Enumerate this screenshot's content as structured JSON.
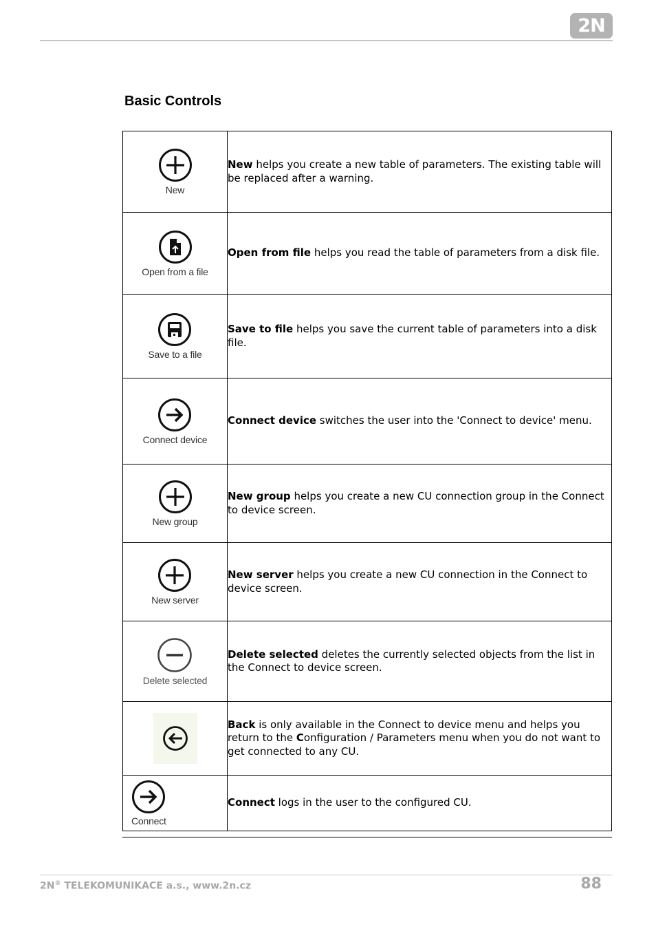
{
  "header": {
    "logo_text": "2N"
  },
  "section": {
    "title": "Basic Controls"
  },
  "controls": [
    {
      "icon": "plus-circle-icon",
      "label": "New",
      "bold": "New",
      "text": " helps you create a new table of parameters. The existing table will be replaced after a warning."
    },
    {
      "icon": "open-file-icon",
      "label": "Open from a file",
      "bold": "Open from file",
      "text": " helps you read the table of parameters from a disk file."
    },
    {
      "icon": "save-file-icon",
      "label": "Save to a file",
      "bold": "Save to file",
      "text": " helps you save the current table of parameters into a disk file."
    },
    {
      "icon": "arrow-right-circle-icon",
      "label": "Connect device",
      "bold": "Connect device",
      "text": " switches the user into the 'Connect to device' menu."
    },
    {
      "icon": "plus-circle-icon",
      "label": "New group",
      "bold": "New group",
      "text": " helps you create a new CU connection group in the Connect to device screen."
    },
    {
      "icon": "plus-circle-icon",
      "label": "New server",
      "bold": "New server",
      "text": " helps you create a new CU connection in the Connect to device screen."
    },
    {
      "icon": "minus-circle-icon",
      "label": "Delete selected",
      "bold": "Delete selected",
      "text": " deletes the currently selected objects from the list in the Connect to device screen."
    },
    {
      "icon": "arrow-left-circle-icon",
      "label": "",
      "bold": "Back",
      "text_a": " is only available in the Connect to device menu and helps you return to the ",
      "bold_b": "C",
      "text_b": "onfiguration / Parameters menu when you do not want to get connected to any CU."
    },
    {
      "icon": "arrow-right-circle-icon",
      "label": "Connect",
      "bold": "Connect",
      "text": " logs in the user to the configured CU."
    }
  ],
  "footer": {
    "company_prefix": "2N",
    "registered": "®",
    "company_rest": " TELEKOMUNIKACE a.s., www.2n.cz",
    "page_number": "88"
  }
}
